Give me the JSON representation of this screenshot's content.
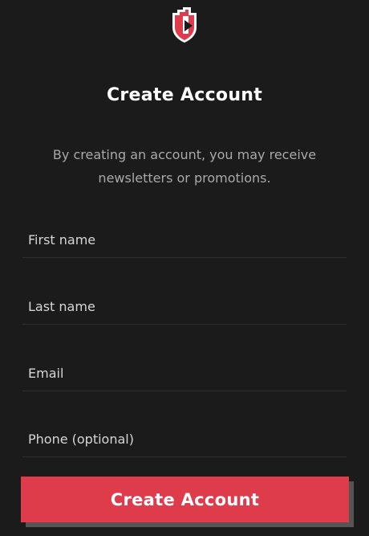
{
  "header": {
    "logo_icon": "shield-play-logo-icon",
    "title": "Create Account",
    "subtitle": "By creating an account, you may receive newsletters or promotions."
  },
  "form": {
    "first_name": {
      "placeholder": "First name",
      "value": ""
    },
    "last_name": {
      "placeholder": "Last name",
      "value": ""
    },
    "email": {
      "placeholder": "Email",
      "value": ""
    },
    "phone": {
      "placeholder": "Phone (optional)",
      "value": ""
    },
    "submit_label": "Create Account"
  },
  "colors": {
    "background": "#1b1b1b",
    "accent": "#de3c4b",
    "field_border": "#2f2f2f",
    "muted_text": "#a9a9a9"
  }
}
